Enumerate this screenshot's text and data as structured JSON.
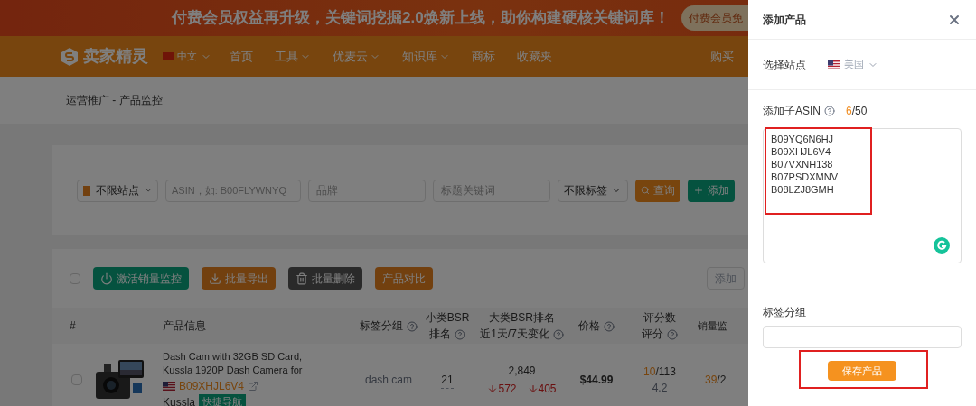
{
  "banner": {
    "text": "付费会员权益再升级，关键词挖掘2.0焕新上线，助你构建硬核关键词库！",
    "button": "付费会员免"
  },
  "nav": {
    "logo": "卖家精灵",
    "language": "中文",
    "items": [
      {
        "label": "首页",
        "dropdown": false
      },
      {
        "label": "工具",
        "dropdown": true
      },
      {
        "label": "优麦云",
        "dropdown": true
      },
      {
        "label": "知识库",
        "dropdown": true
      },
      {
        "label": "商标",
        "dropdown": false
      },
      {
        "label": "收藏夹",
        "dropdown": false
      }
    ],
    "right": "购买"
  },
  "breadcrumb": "运营推广 - 产品监控",
  "filters": {
    "site": "不限站点",
    "asin_placeholder": "ASIN，如: B00FLYWNYQ",
    "brand_placeholder": "品牌",
    "keyword_placeholder": "标题关键词",
    "tag": "不限标签",
    "search_button": "查询",
    "add_button": "添加"
  },
  "toolbar": {
    "select_all_checked": false,
    "buttons": [
      {
        "label": "激活销量监控",
        "kind": "power"
      },
      {
        "label": "批量导出",
        "kind": "export"
      },
      {
        "label": "批量删除",
        "kind": "trash"
      },
      {
        "label": "产品对比",
        "kind": "compare"
      }
    ],
    "right_field": "添加"
  },
  "table": {
    "columns": [
      {
        "label": "#",
        "help": false
      },
      {
        "label": "产品信息",
        "help": false
      },
      {
        "label": "标签分组",
        "help": true
      },
      {
        "label": "小类BSR",
        "sub": "排名",
        "help": true
      },
      {
        "label": "大类BSR排名",
        "sub": "近1天/7天变化",
        "help": true
      },
      {
        "label": "价格",
        "help": true
      },
      {
        "label": "评分数",
        "sub": "评分",
        "help": true
      },
      {
        "label": "销量监",
        "help": false
      }
    ],
    "rows": [
      {
        "checked": false,
        "title": "Dash Cam with 32GB SD Card, Kussla 1920P Dash Camera for",
        "asin": "B09XHJL6V4",
        "brand": "Kussla",
        "badge": "快捷导航",
        "tag": "dash cam",
        "small_bsr": "21",
        "big_bsr": "2,849",
        "change_1d": "572",
        "change_7d": "405",
        "price": "$44.99",
        "rating_count": "10",
        "rating_total": "/113",
        "rating": "4.2",
        "sales": "39",
        "sales_rest": "/2"
      }
    ]
  },
  "drawer": {
    "title": "添加产品",
    "site_label": "选择站点",
    "site_value": "美国",
    "asin_label": "添加子ASIN",
    "asin_count": "6",
    "asin_max": "/50",
    "asins": [
      "B09YQ6N6HJ",
      "B09XHJL6V4",
      "B07VXNH138",
      "B07PSDXMNV",
      "B08LZJ8GMH"
    ],
    "tag_label": "标签分组",
    "save_button": "保存产品"
  }
}
